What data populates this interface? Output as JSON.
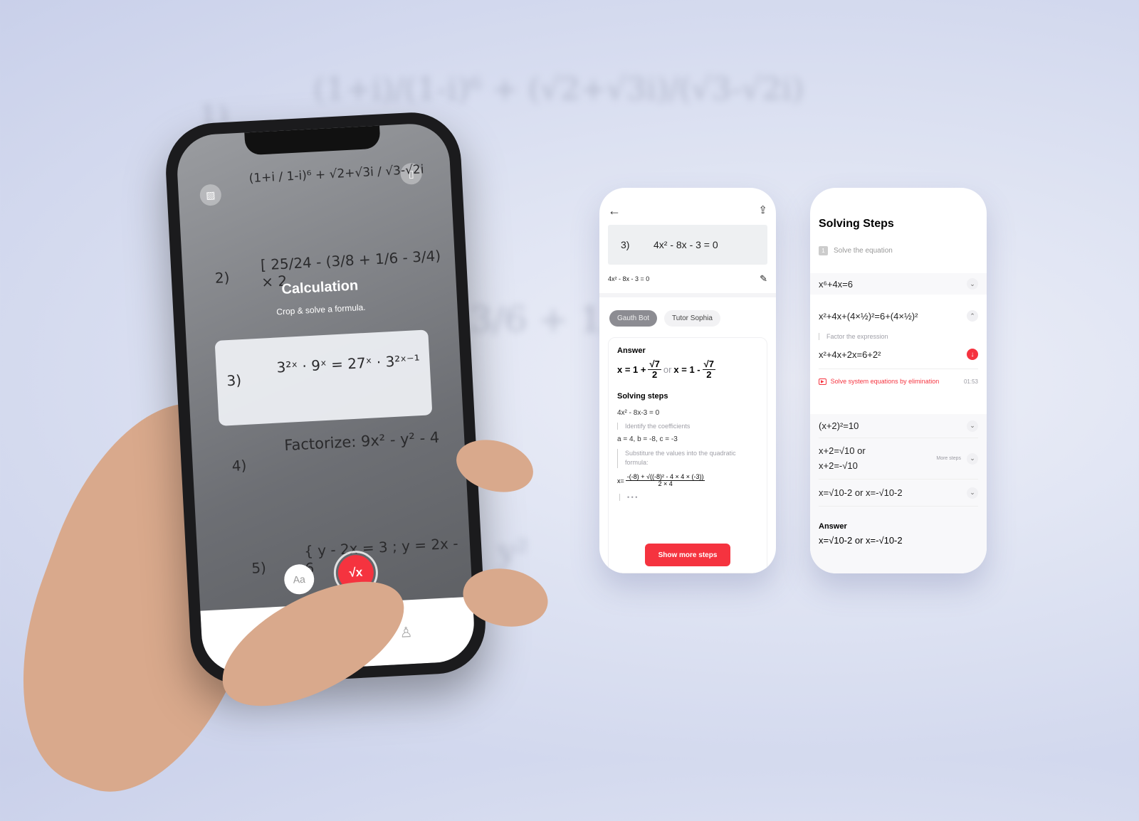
{
  "background_formulas": [
    "1)",
    "(1+i)/(1-i)⁶ + (√2+√3i)/(√3-√2i)",
    "3/6 + 1/6",
    "y²"
  ],
  "phone": {
    "formula_1": "(1+i / 1-i)⁶ + √2+√3i / √3-√2i",
    "formula_2_label": "2)",
    "formula_2": "[ 25/24 - (3/8 + 1/6 - 3/4) × 2",
    "title": "Calculation",
    "subtitle": "Crop & solve a formula.",
    "crop_label": "3)",
    "crop_formula": "3²ˣ · 9ˣ = 27ˣ · 3²ˣ⁻¹",
    "formula_4_label": "4)",
    "formula_4": "Factorize:  9x² - y² - 4",
    "formula_5_label": "5)",
    "formula_5": "{ y - 2x = 3 ;  y = 2x - 6",
    "text_mode_button": "Aa",
    "solve_button": "√x",
    "accent": "#f5333f"
  },
  "card1": {
    "problem_label": "3)",
    "problem": "4x² - 8x - 3  = 0",
    "recognized": "4x² - 8x - 3 = 0",
    "tabs": [
      {
        "label": "Gauth Bot",
        "active": true
      },
      {
        "label": "Tutor Sophia",
        "active": false
      }
    ],
    "answer_heading": "Answer",
    "answer": {
      "x1": "x = 1 +",
      "num": "√7",
      "den": "2",
      "or": "or",
      "x2": "x = 1 -"
    },
    "steps_heading": "Solving steps",
    "steps": [
      {
        "expr": "4x² - 8x-3 = 0",
        "note": "Identify the coefficients"
      },
      {
        "expr": "a = 4, b = -8, c = -3",
        "note": "Substiture the values into the quadratic formula:"
      }
    ],
    "formula": {
      "lhs": "x=",
      "num": "-(-8) + √((-8)² - 4 × 4 × (-3))",
      "den": "2 × 4"
    },
    "ellipsis": "• • •",
    "show_more": "Show more steps"
  },
  "card2": {
    "title": "Solving Steps",
    "step_number": "1",
    "step_label": "Solve the equation",
    "rows": [
      "x⁶+4x=6",
      "x²+4x+(4×½)²=6+(4×½)²"
    ],
    "factor_note": "Factor the expression",
    "factored": "x²+4x+2x=6+2²",
    "video_label": "Solve system equations by elimination",
    "video_time": "01:53",
    "rows2": [
      "(x+2)²=10",
      "x+2=√10 or",
      "x+2=-√10",
      "x=√10-2 or x=-√10-2"
    ],
    "more_steps": "More steps",
    "answer_heading": "Answer",
    "answer": "x=√10-2 or x=-√10-2"
  }
}
